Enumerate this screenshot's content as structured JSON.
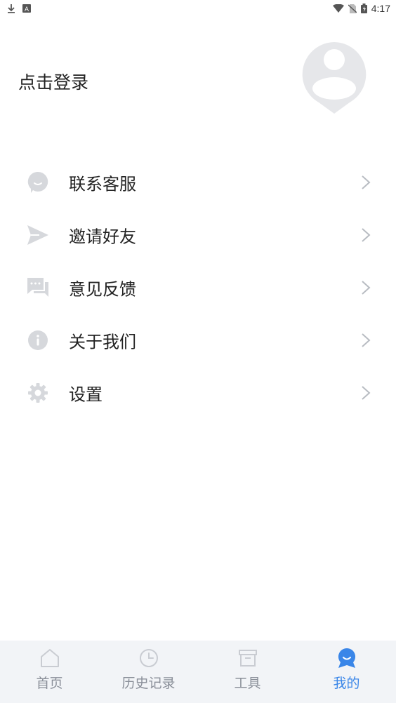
{
  "status_bar": {
    "time": "4:17",
    "left_icons": [
      "download-icon",
      "a-badge-icon"
    ],
    "right_icons": [
      "wifi-icon",
      "no-sim-icon",
      "battery-icon"
    ]
  },
  "profile": {
    "login_text": "点击登录",
    "avatar_icon": "default-avatar-icon"
  },
  "menu": [
    {
      "label": "联系客服",
      "icon": "chat-bubble-icon"
    },
    {
      "label": "邀请好友",
      "icon": "send-icon"
    },
    {
      "label": "意见反馈",
      "icon": "feedback-icon"
    },
    {
      "label": "关于我们",
      "icon": "info-icon"
    },
    {
      "label": "设置",
      "icon": "gear-icon"
    }
  ],
  "tabs": [
    {
      "label": "首页",
      "icon": "home-icon",
      "active": false
    },
    {
      "label": "历史记录",
      "icon": "clock-icon",
      "active": false
    },
    {
      "label": "工具",
      "icon": "archive-box-icon",
      "active": false
    },
    {
      "label": "我的",
      "icon": "profile-icon",
      "active": true
    }
  ],
  "colors": {
    "accent": "#3a86e8",
    "icon_gray": "#d6d8dc",
    "tab_inactive": "#8a8f99",
    "tabbar_bg": "#f2f4f7"
  }
}
